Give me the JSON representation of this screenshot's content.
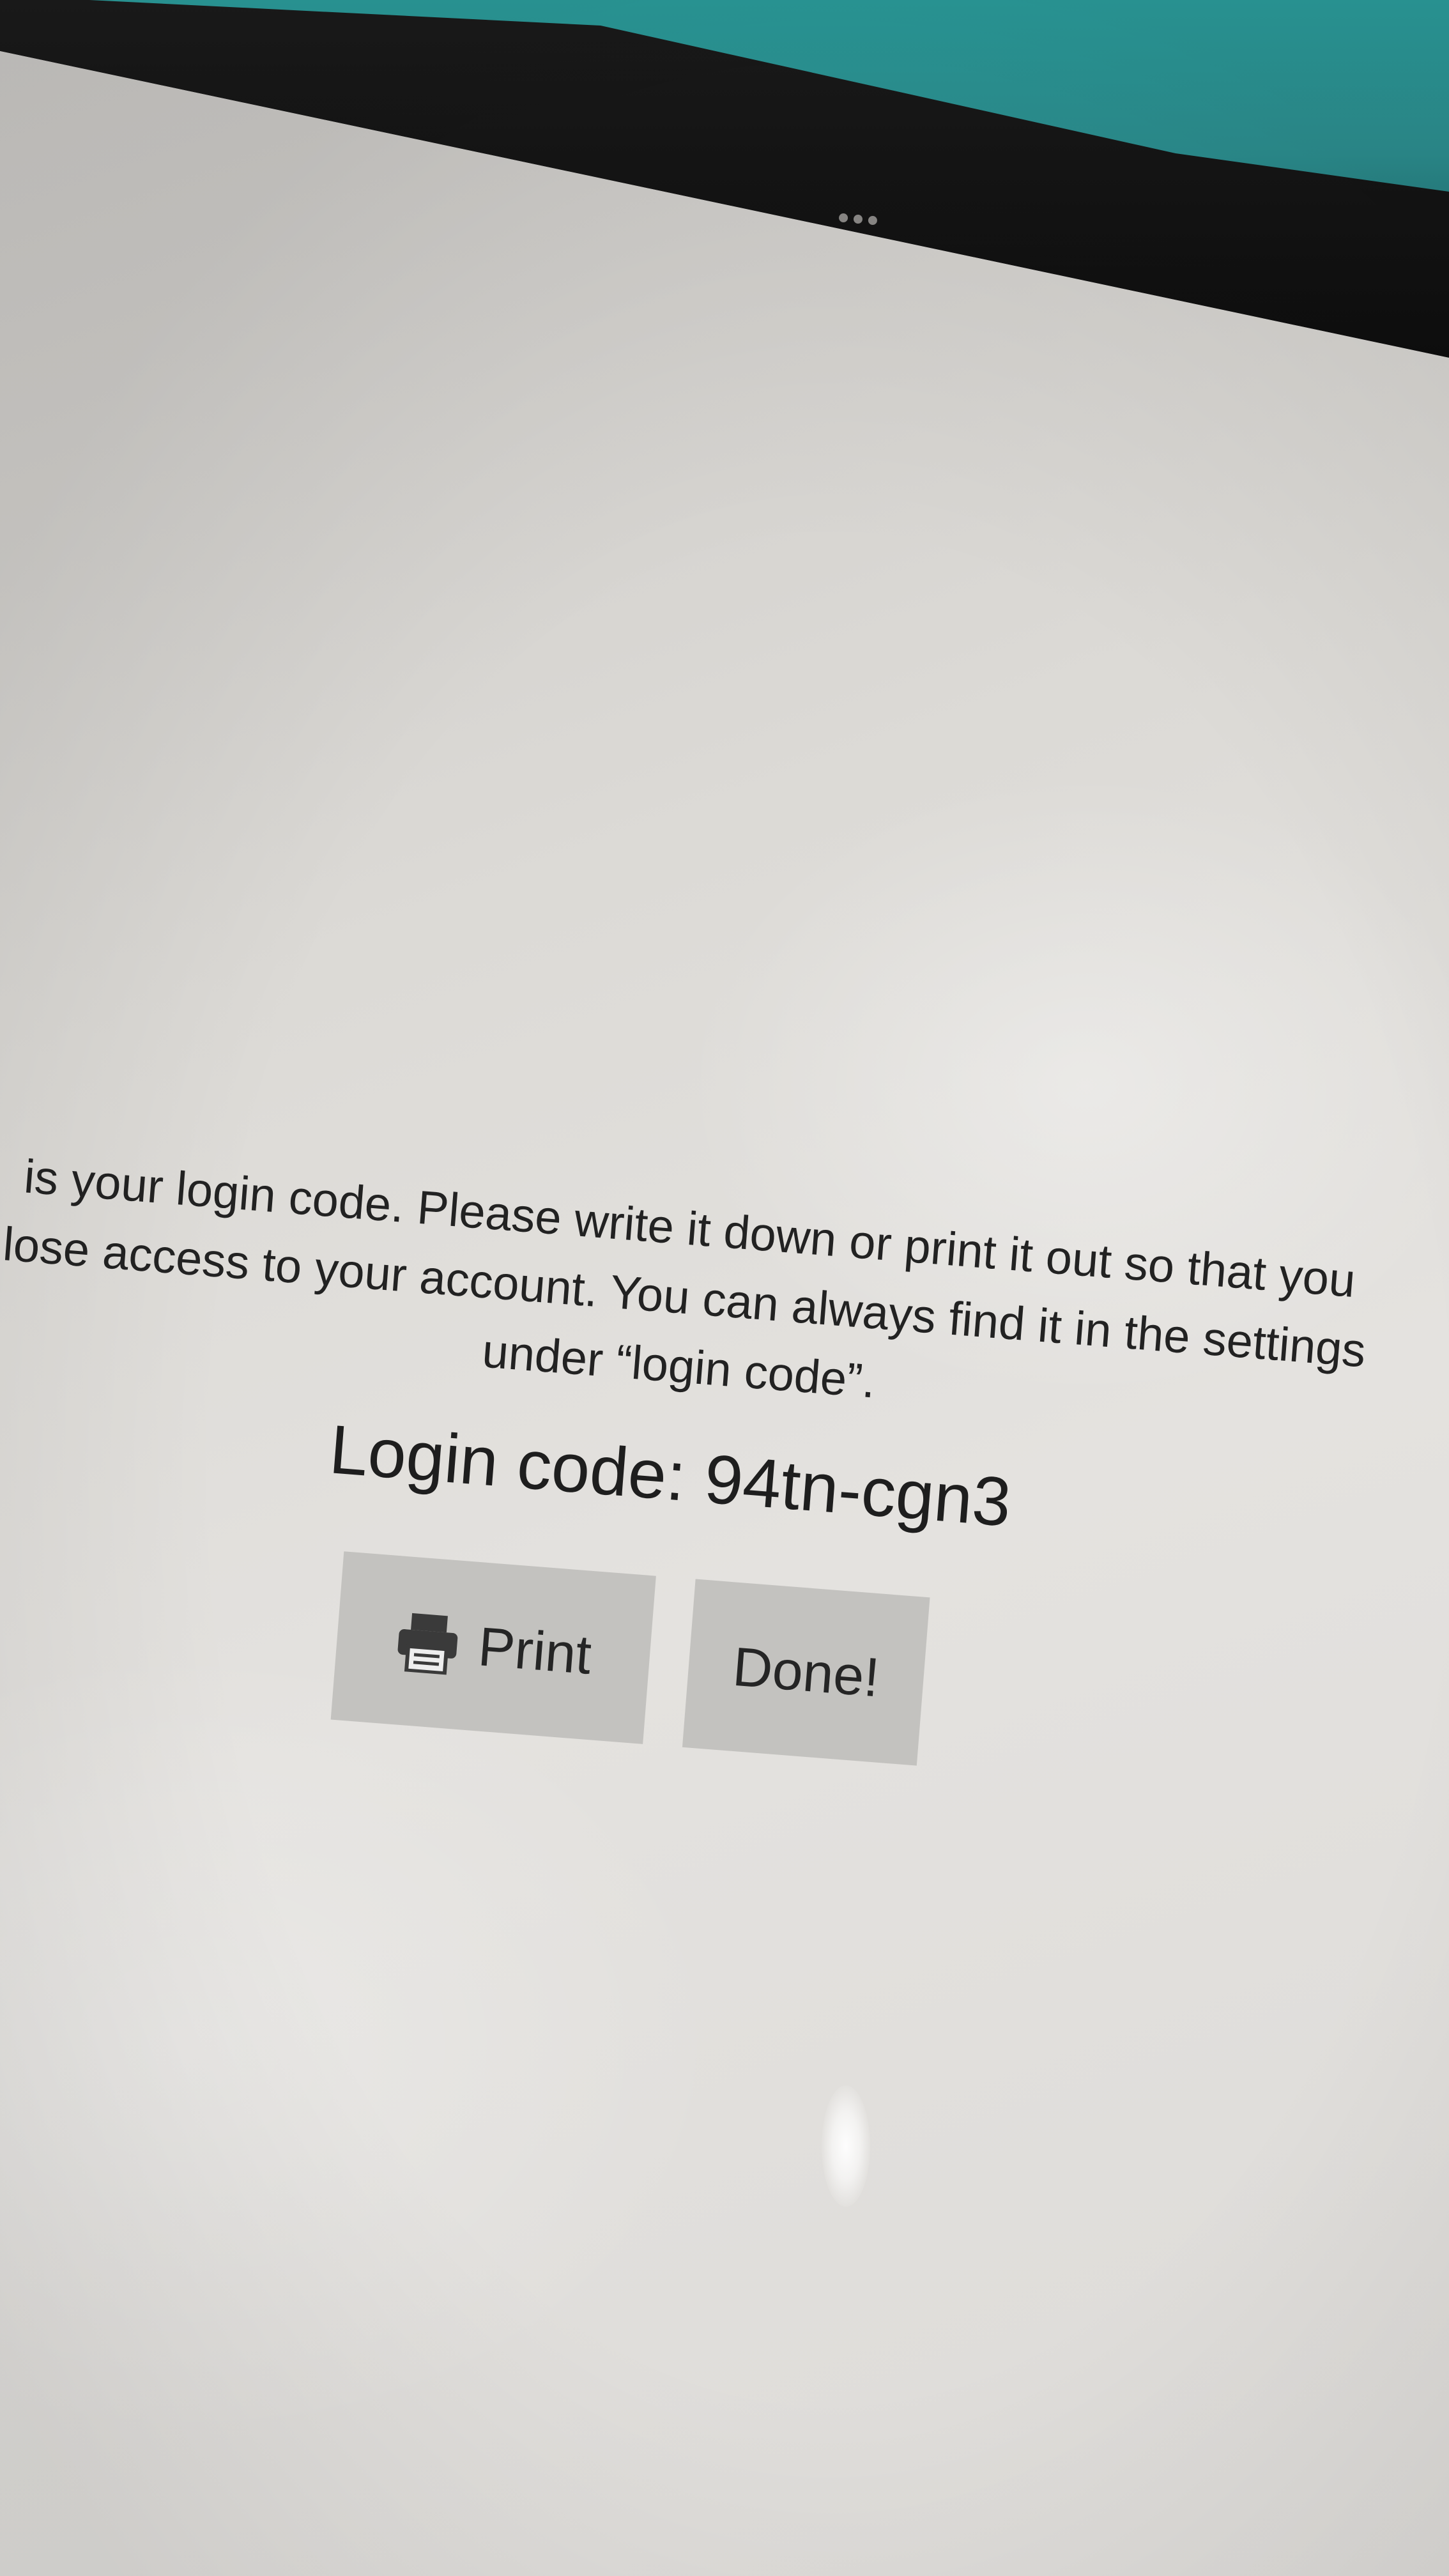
{
  "dialog": {
    "message_line1": "is your login code. Please write it down or print it out so that you",
    "message_line2": "lose access to your account. You can always find it in the settings",
    "message_line3": "under “login code”.",
    "login_label": "Login code:",
    "login_code": "94tn-cgn3",
    "print_label": "Print",
    "done_label": "Done!"
  },
  "icons": {
    "print": "printer-icon",
    "handle": "more-dots-icon"
  },
  "colors": {
    "screen_background": "#dcdad6",
    "button_background": "#c3c2bf",
    "text": "#222222",
    "case_teal": "#2b9d9c",
    "bezel": "#111111"
  }
}
